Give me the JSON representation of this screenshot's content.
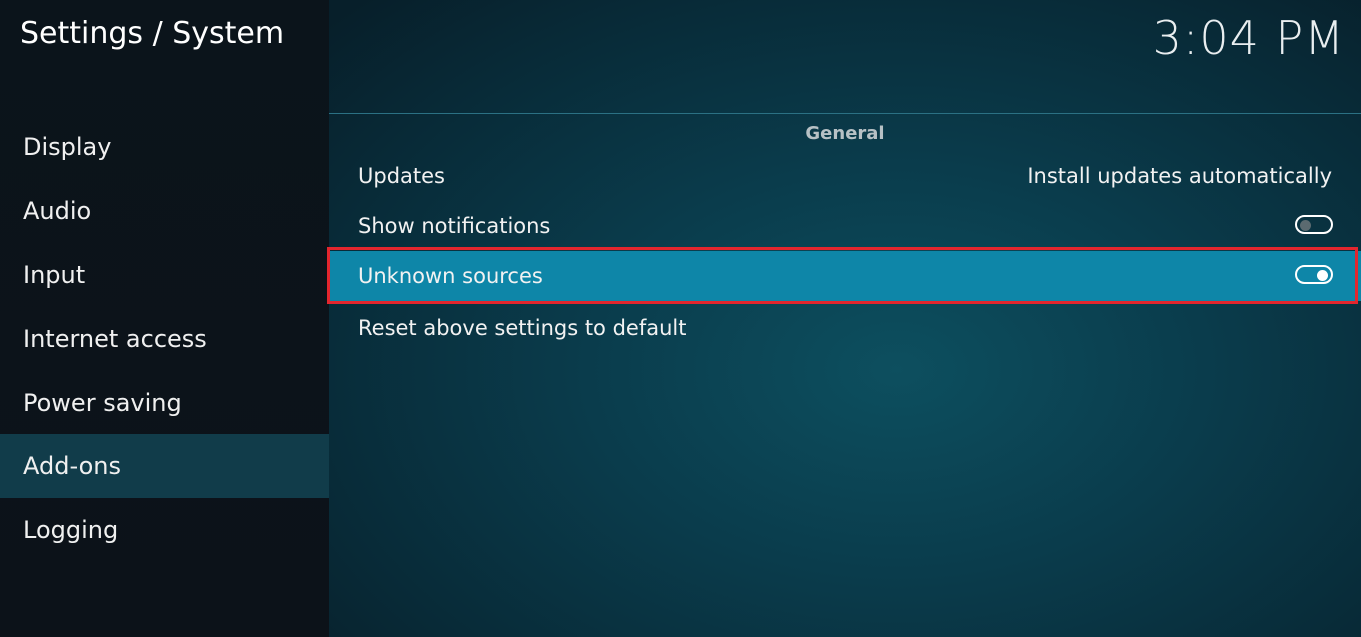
{
  "header": {
    "title": "Settings / System",
    "clock": "3:04 PM"
  },
  "sidebar": {
    "items": [
      {
        "label": "Display",
        "active": false
      },
      {
        "label": "Audio",
        "active": false
      },
      {
        "label": "Input",
        "active": false
      },
      {
        "label": "Internet access",
        "active": false
      },
      {
        "label": "Power saving",
        "active": false
      },
      {
        "label": "Add-ons",
        "active": true
      },
      {
        "label": "Logging",
        "active": false
      }
    ]
  },
  "main": {
    "section_title": "General",
    "settings": [
      {
        "label": "Updates",
        "value": "Install updates automatically"
      },
      {
        "label": "Show notifications",
        "toggle": "off"
      },
      {
        "label": "Unknown sources",
        "toggle": "on",
        "selected": true,
        "highlighted": true
      },
      {
        "label": "Reset above settings to default"
      }
    ]
  },
  "colors": {
    "accent_selected_row": "#0e86a8",
    "active_sidebar_item": "#113c4a",
    "highlight_frame": "#e3262e"
  },
  "icons": {
    "toggle_off": "toggle-off-icon",
    "toggle_on": "toggle-on-icon"
  }
}
